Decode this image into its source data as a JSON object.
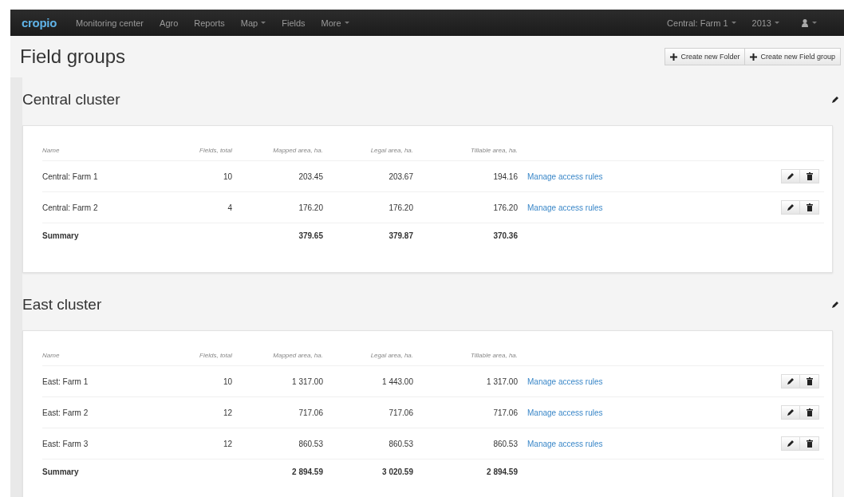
{
  "navbar": {
    "logo": "cropio",
    "items": [
      {
        "label": "Monitoring center",
        "dropdown": false
      },
      {
        "label": "Agro",
        "dropdown": false
      },
      {
        "label": "Reports",
        "dropdown": false
      },
      {
        "label": "Map",
        "dropdown": true
      },
      {
        "label": "Fields",
        "dropdown": false
      },
      {
        "label": "More",
        "dropdown": true
      }
    ],
    "right_items": [
      {
        "label": "Central: Farm 1",
        "dropdown": true
      },
      {
        "label": "2013",
        "dropdown": true
      }
    ],
    "user_menu": {
      "dropdown": true
    }
  },
  "page_title": "Field groups",
  "actions": [
    "Create new Folder",
    "Create new Field group"
  ],
  "groups": [
    {
      "title": "Central cluster",
      "columns": [
        "Name",
        "Fields, total",
        "Mapped area, ha.",
        "Legal area, ha.",
        "Tillable area, ha."
      ],
      "rows": [
        {
          "name": "Central: Farm 1",
          "fields": "10",
          "mapped": "203.45",
          "legal": "203.67",
          "tillable": "194.16",
          "link": "Manage access rules"
        },
        {
          "name": "Central: Farm 2",
          "fields": "4",
          "mapped": "176.20",
          "legal": "176.20",
          "tillable": "176.20",
          "link": "Manage access rules"
        }
      ],
      "summary": {
        "label": "Summary",
        "mapped": "379.65",
        "legal": "379.87",
        "tillable": "370.36"
      }
    },
    {
      "title": "East cluster",
      "columns": [
        "Name",
        "Fields, total",
        "Mapped area, ha.",
        "Legal area, ha.",
        "Tillable area, ha."
      ],
      "rows": [
        {
          "name": "East: Farm 1",
          "fields": "10",
          "mapped": "1 317.00",
          "legal": "1 443.00",
          "tillable": "1 317.00",
          "link": "Manage access rules"
        },
        {
          "name": "East: Farm 2",
          "fields": "12",
          "mapped": "717.06",
          "legal": "717.06",
          "tillable": "717.06",
          "link": "Manage access rules"
        },
        {
          "name": "East: Farm 3",
          "fields": "12",
          "mapped": "860.53",
          "legal": "860.53",
          "tillable": "860.53",
          "link": "Manage access rules"
        }
      ],
      "summary": {
        "label": "Summary",
        "mapped": "2 894.59",
        "legal": "3 020.59",
        "tillable": "2 894.59"
      }
    }
  ]
}
